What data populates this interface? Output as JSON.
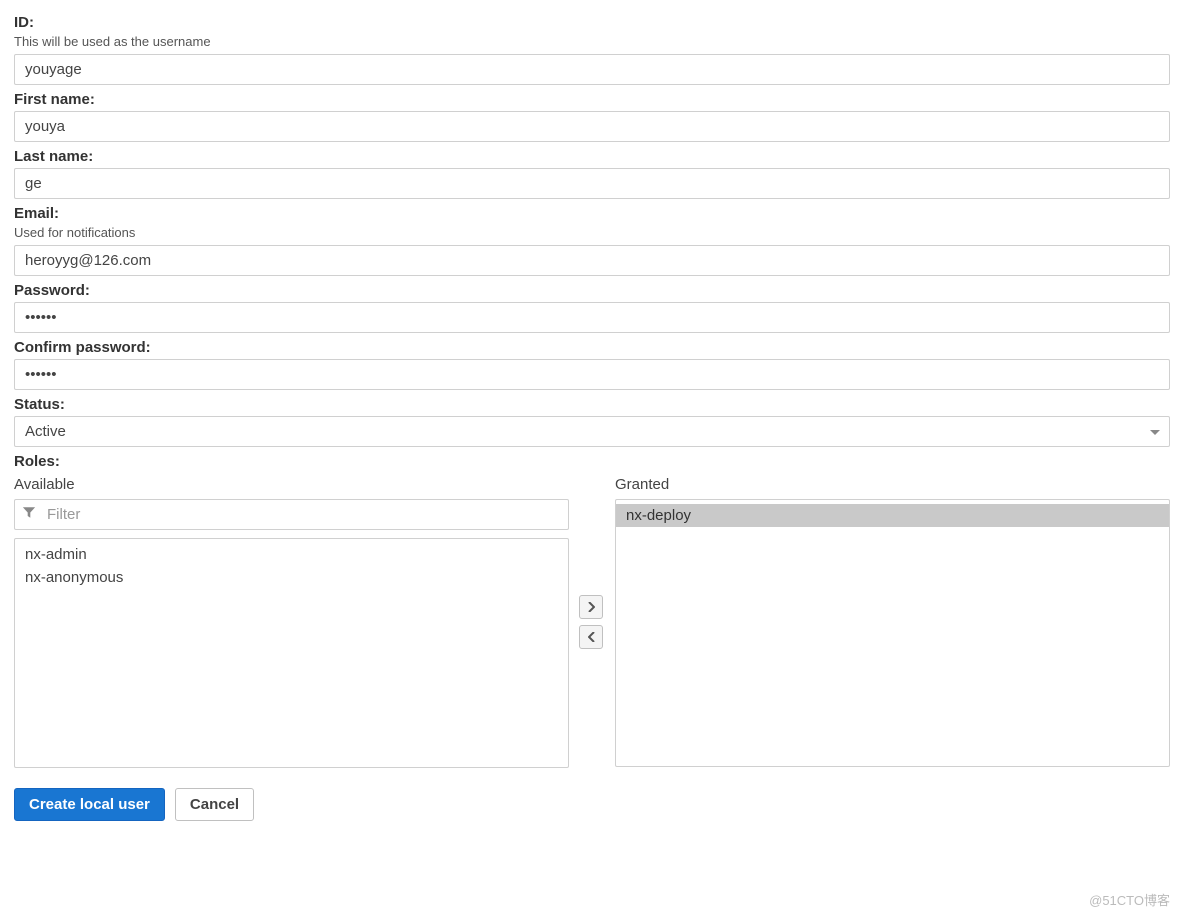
{
  "fields": {
    "id": {
      "label": "ID:",
      "help": "This will be used as the username",
      "value": "youyage"
    },
    "first_name": {
      "label": "First name:",
      "value": "youya"
    },
    "last_name": {
      "label": "Last name:",
      "value": "ge"
    },
    "email": {
      "label": "Email:",
      "help": "Used for notifications",
      "value": "heroyyg@126.com"
    },
    "password": {
      "label": "Password:",
      "value": "••••••"
    },
    "confirm_password": {
      "label": "Confirm password:",
      "value": "••••••"
    },
    "status": {
      "label": "Status:",
      "value": "Active"
    },
    "roles": {
      "label": "Roles:",
      "available_label": "Available",
      "granted_label": "Granted",
      "filter_placeholder": "Filter",
      "available": [
        "nx-admin",
        "nx-anonymous"
      ],
      "granted": [
        "nx-deploy"
      ]
    }
  },
  "actions": {
    "create": "Create local user",
    "cancel": "Cancel"
  },
  "watermark": "@51CTO博客"
}
